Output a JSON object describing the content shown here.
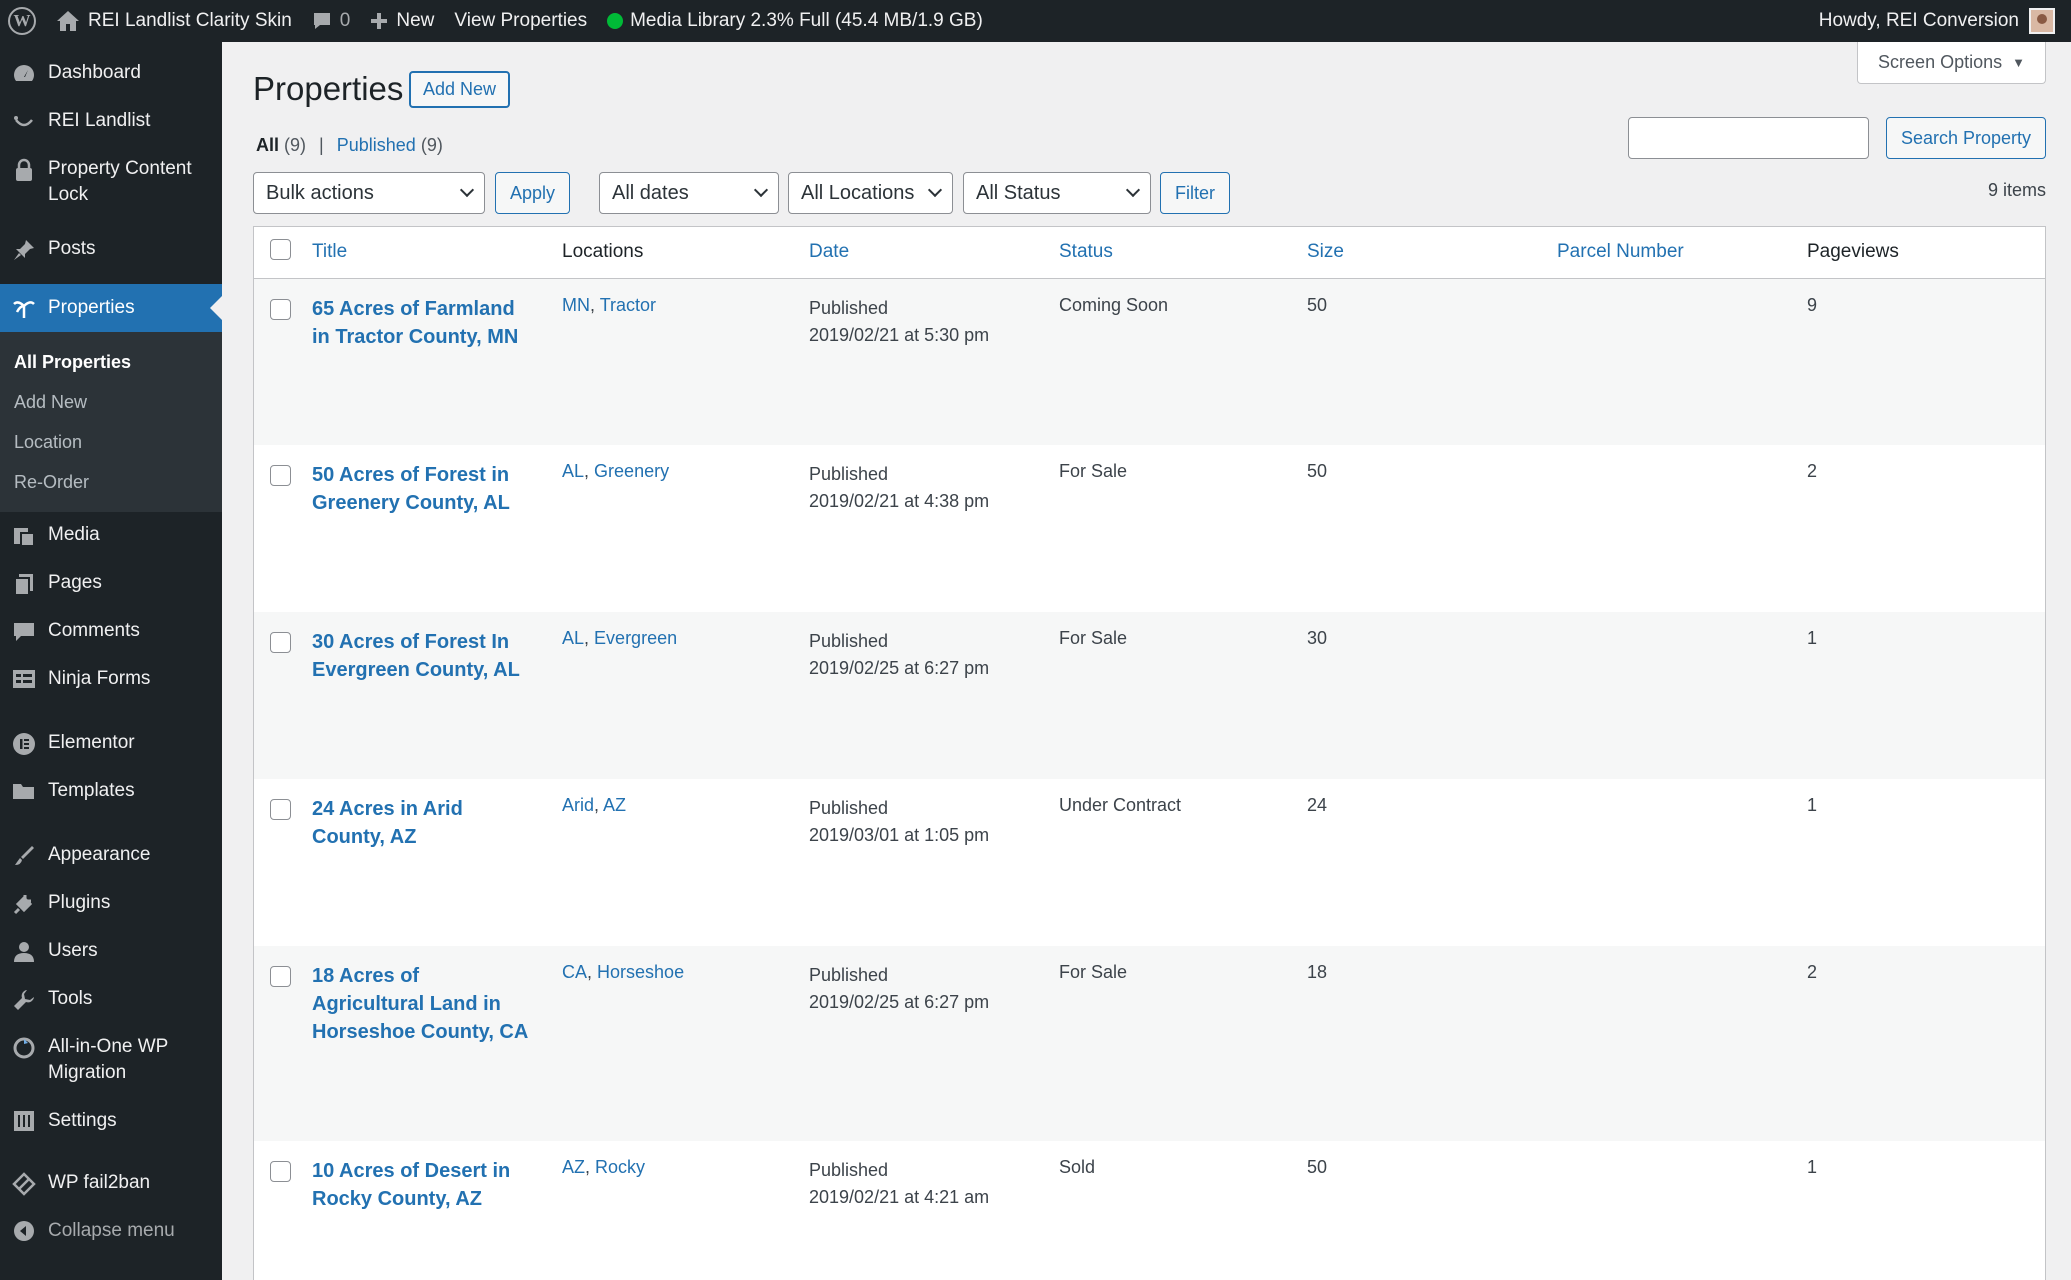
{
  "adminbar": {
    "site_name": "REI Landlist Clarity Skin",
    "comments_count": "0",
    "new_label": "New",
    "view_label": "View Properties",
    "media_status": "Media Library 2.3% Full (45.4 MB/1.9 GB)",
    "howdy": "Howdy, REI Conversion"
  },
  "sidebar": {
    "items": [
      {
        "label": "Dashboard",
        "icon": "dashboard-icon"
      },
      {
        "label": "REI Landlist",
        "icon": "smile-icon"
      },
      {
        "label": "Property Content Lock",
        "icon": "lock-icon"
      },
      {
        "label": "Posts",
        "icon": "pin-icon"
      },
      {
        "label": "Properties",
        "icon": "palm-tree-icon"
      },
      {
        "label": "Media",
        "icon": "media-icon"
      },
      {
        "label": "Pages",
        "icon": "pages-icon"
      },
      {
        "label": "Comments",
        "icon": "comment-icon"
      },
      {
        "label": "Ninja Forms",
        "icon": "forms-icon"
      },
      {
        "label": "Elementor",
        "icon": "elementor-icon"
      },
      {
        "label": "Templates",
        "icon": "folder-icon"
      },
      {
        "label": "Appearance",
        "icon": "brush-icon"
      },
      {
        "label": "Plugins",
        "icon": "plugin-icon"
      },
      {
        "label": "Users",
        "icon": "user-icon"
      },
      {
        "label": "Tools",
        "icon": "wrench-icon"
      },
      {
        "label": "All-in-One WP Migration",
        "icon": "migration-icon"
      },
      {
        "label": "Settings",
        "icon": "settings-icon"
      },
      {
        "label": "WP fail2ban",
        "icon": "shield-icon"
      }
    ],
    "submenu": [
      "All Properties",
      "Add New",
      "Location",
      "Re-Order"
    ],
    "collapse": "Collapse menu"
  },
  "main": {
    "screen_options": "Screen Options",
    "title": "Properties",
    "add_new": "Add New",
    "views": {
      "all": "All",
      "all_count": "(9)",
      "published": "Published",
      "published_count": "(9)"
    },
    "search_button": "Search Property",
    "bulk_actions": "Bulk actions",
    "apply": "Apply",
    "dates_filter": "All dates",
    "locations_filter": "All Locations",
    "status_filter": "All Status",
    "filter_button": "Filter",
    "items_count": "9 items"
  },
  "table": {
    "headers": {
      "title": "Title",
      "locations": "Locations",
      "date": "Date",
      "status": "Status",
      "size": "Size",
      "parcel": "Parcel Number",
      "pageviews": "Pageviews"
    },
    "rows": [
      {
        "title": "65 Acres of Farmland in Tractor County, MN",
        "loc1": "MN",
        "loc2": "Tractor",
        "date_status": "Published",
        "date": "2019/02/21 at 5:30 pm",
        "status": "Coming Soon",
        "size": "50",
        "parcel": "",
        "pageviews": "9"
      },
      {
        "title": "50 Acres of Forest in Greenery County, AL",
        "loc1": "AL",
        "loc2": "Greenery",
        "date_status": "Published",
        "date": "2019/02/21 at 4:38 pm",
        "status": "For Sale",
        "size": "50",
        "parcel": "",
        "pageviews": "2"
      },
      {
        "title": "30 Acres of Forest In Evergreen County, AL",
        "loc1": "AL",
        "loc2": "Evergreen",
        "date_status": "Published",
        "date": "2019/02/25 at 6:27 pm",
        "status": "For Sale",
        "size": "30",
        "parcel": "",
        "pageviews": "1"
      },
      {
        "title": "24 Acres in Arid County, AZ",
        "loc1": "Arid",
        "loc2": "AZ",
        "date_status": "Published",
        "date": "2019/03/01 at 1:05 pm",
        "status": "Under Contract",
        "size": "24",
        "parcel": "",
        "pageviews": "1"
      },
      {
        "title": "18 Acres of Agricultural Land in Horseshoe County, CA",
        "loc1": "CA",
        "loc2": "Horseshoe",
        "date_status": "Published",
        "date": "2019/02/25 at 6:27 pm",
        "status": "For Sale",
        "size": "18",
        "parcel": "",
        "pageviews": "2"
      },
      {
        "title": "10 Acres of Desert in Rocky County, AZ",
        "loc1": "AZ",
        "loc2": "Rocky",
        "date_status": "Published",
        "date": "2019/02/21 at 4:21 am",
        "status": "Sold",
        "size": "50",
        "parcel": "",
        "pageviews": "1"
      }
    ]
  },
  "colors": {
    "adminbar": "#1d2327",
    "accent": "#2271b1",
    "background": "#f0f0f1",
    "online_dot": "#00ba37"
  }
}
